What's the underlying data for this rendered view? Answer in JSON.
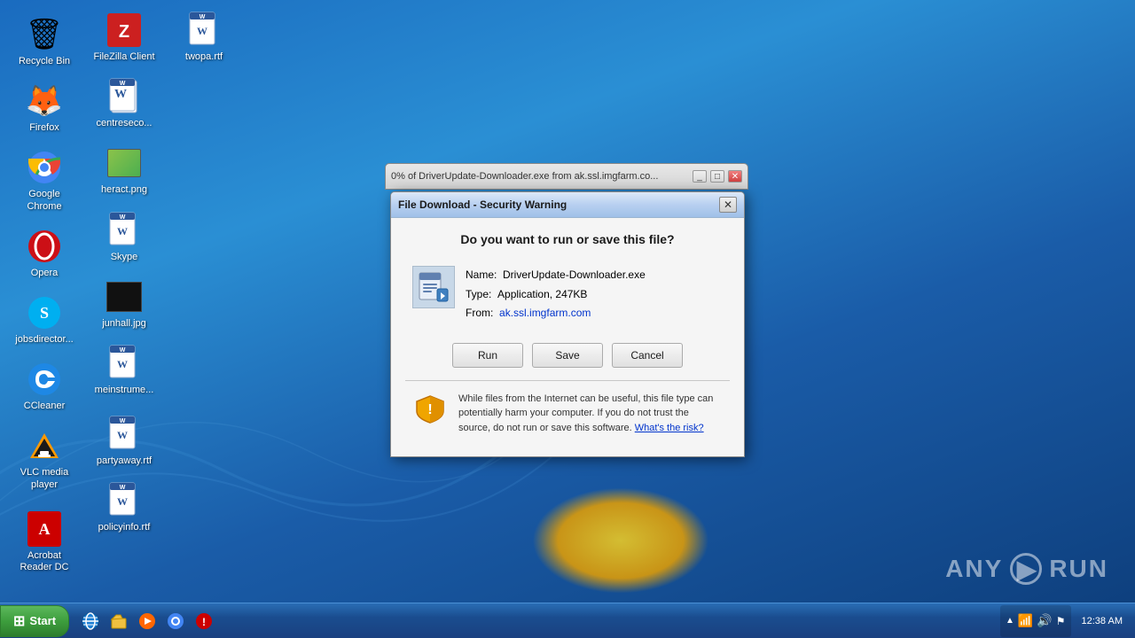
{
  "desktop": {
    "background_colors": [
      "#1a6bbf",
      "#2a8fd4",
      "#0d3d7a"
    ],
    "icons": [
      {
        "id": "recycle-bin",
        "label": "Recycle Bin",
        "type": "recycle"
      },
      {
        "id": "acrobat",
        "label": "Acrobat Reader DC",
        "type": "acrobat"
      },
      {
        "id": "partyaway",
        "label": "partyaway.rtf",
        "type": "word"
      },
      {
        "id": "firefox",
        "label": "Firefox",
        "type": "firefox"
      },
      {
        "id": "filezilla",
        "label": "FileZilla Client",
        "type": "filezilla"
      },
      {
        "id": "policyinfo",
        "label": "policyinfo.rtf",
        "type": "word"
      },
      {
        "id": "chrome",
        "label": "Google Chrome",
        "type": "chrome"
      },
      {
        "id": "centreseco",
        "label": "centreseco...",
        "type": "word"
      },
      {
        "id": "twopa",
        "label": "twopa.rtf",
        "type": "word"
      },
      {
        "id": "opera",
        "label": "Opera",
        "type": "opera"
      },
      {
        "id": "heract",
        "label": "heract.png",
        "type": "image"
      },
      {
        "id": "skype",
        "label": "Skype",
        "type": "skype"
      },
      {
        "id": "jobsdirector",
        "label": "jobsdirector...",
        "type": "word"
      },
      {
        "id": "ccleaner",
        "label": "CCleaner",
        "type": "ccleaner"
      },
      {
        "id": "junhall",
        "label": "junhall.jpg",
        "type": "imgblack"
      },
      {
        "id": "vlc",
        "label": "VLC media player",
        "type": "vlc"
      },
      {
        "id": "meinstrum",
        "label": "meinstrume...",
        "type": "word"
      }
    ]
  },
  "progress_window": {
    "title": "0% of DriverUpdate-Downloader.exe from ak.ssl.imgfarm.co...",
    "controls": [
      "minimize",
      "restore",
      "close"
    ]
  },
  "security_dialog": {
    "title": "File Download - Security Warning",
    "question": "Do you want to run or save this file?",
    "file_name_label": "Name:",
    "file_name_value": "DriverUpdate-Downloader.exe",
    "file_type_label": "Type:",
    "file_type_value": "Application, 247KB",
    "file_from_label": "From:",
    "file_from_value": "ak.ssl.imgfarm.com",
    "buttons": {
      "run": "Run",
      "save": "Save",
      "cancel": "Cancel"
    },
    "warning_text": "While files from the Internet can be useful, this file type can potentially harm your computer. If you do not trust the source, do not run or save this software.",
    "warning_link": "What's the risk?"
  },
  "taskbar": {
    "start_label": "Start",
    "icons": [
      "ie",
      "explorer",
      "media",
      "chrome",
      "antivirus"
    ],
    "time": "12:38 AM",
    "tray_icons": [
      "network",
      "volume",
      "arrow"
    ]
  },
  "anyrun": {
    "text": "ANY RUN"
  }
}
